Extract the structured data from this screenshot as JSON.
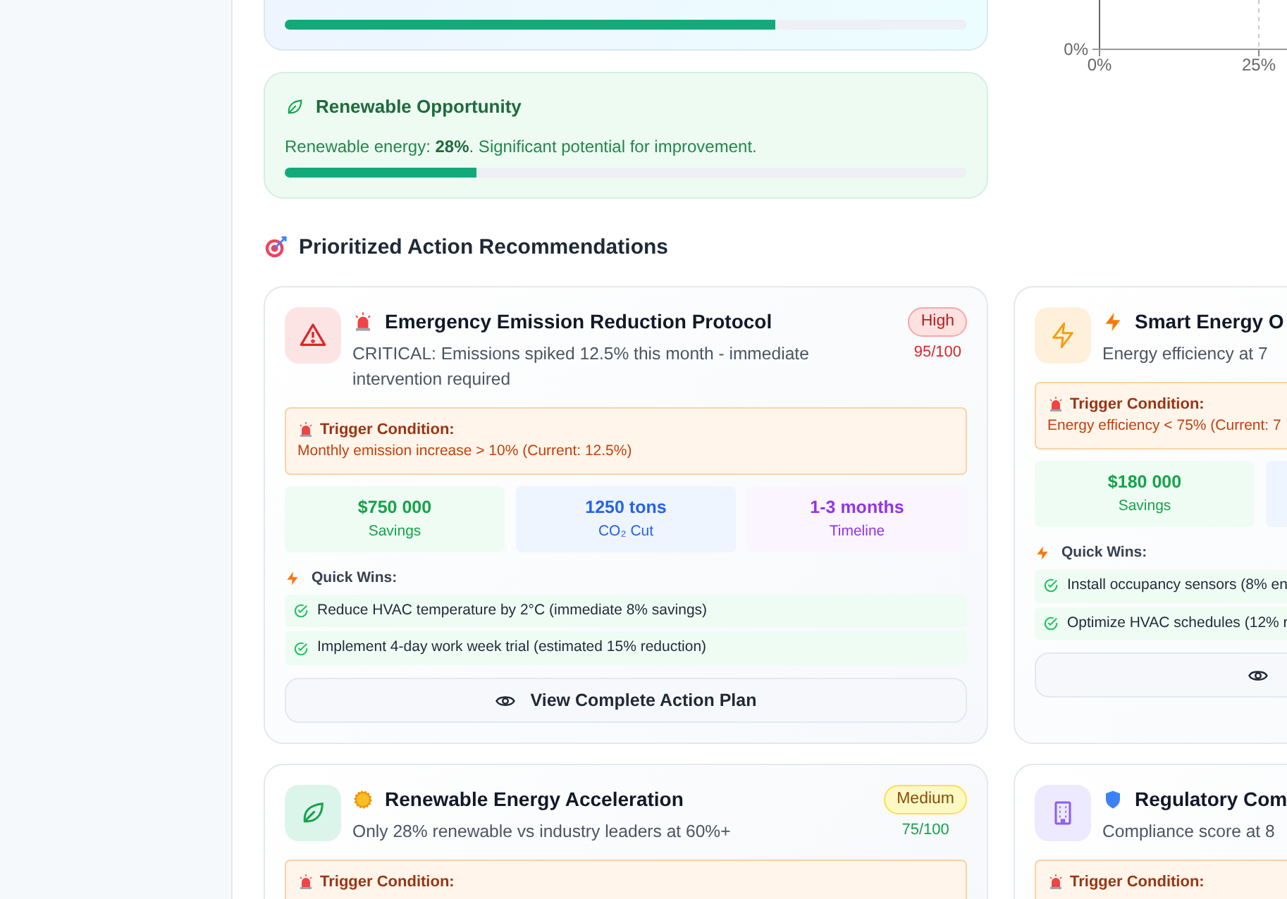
{
  "insights": [
    {
      "kind": "efficiency",
      "level": 0.72
    },
    {
      "kind": "renewable",
      "title": "Renewable Opportunity",
      "text": "Renewable energy: **28%**. Significant potential for improvement.",
      "level": 0.28
    }
  ],
  "chart": {
    "x_tick_labels": [
      "0%",
      "25%"
    ],
    "y_tick_labels": [
      "0%"
    ]
  },
  "recommendations_heading": "Prioritized Action Recommendations",
  "recommendations": [
    {
      "kind": "emergency",
      "title": "Emergency Emission Reduction Protocol",
      "description": "CRITICAL: Emissions spiked 12.5% this month - immediate intervention required",
      "badge": {
        "text": "High",
        "kind": "high"
      },
      "score": "95/100",
      "trigger": {
        "label": "Trigger Condition:",
        "text": "Monthly emission increase > 10% (Current: 12.5%)"
      },
      "metrics": [
        {
          "kind": "savings",
          "value": "$750 000",
          "label": "Savings"
        },
        {
          "kind": "co2",
          "value": "1250 tons",
          "label": "CO₂ Cut"
        },
        {
          "kind": "timeline",
          "value": "1-3 months",
          "label": "Timeline"
        }
      ],
      "quick_wins_label": "Quick Wins:",
      "quick_wins": [
        "Reduce HVAC temperature by 2°C (immediate 8% savings)",
        "Implement 4-day work week trial (estimated 15% reduction)"
      ],
      "button": "View Complete Action Plan"
    },
    {
      "kind": "efficiency",
      "title": "Smart Energy O",
      "description": "Energy efficiency at 7",
      "trigger": {
        "label": "Trigger Condition:",
        "text": "Energy efficiency < 75% (Current: 7"
      },
      "metrics": [
        {
          "kind": "savings",
          "value": "$180 000",
          "label": "Savings"
        },
        {
          "kind": "co2"
        }
      ],
      "quick_wins_label": "Quick Wins:",
      "quick_wins": [
        "Install occupancy sensors (8% en",
        "Optimize HVAC schedules (12% r"
      ]
    },
    {
      "kind": "renewable",
      "title": "Renewable Energy Acceleration",
      "description": "Only 28% renewable vs industry leaders at 60%+",
      "badge": {
        "text": "Medium",
        "kind": "medium"
      },
      "score": "75/100",
      "trigger": {
        "label": "Trigger Condition:"
      }
    },
    {
      "kind": "compliance",
      "title": "Regulatory Com",
      "description": "Compliance score at 8",
      "trigger": {
        "label": "Trigger Condition:"
      }
    }
  ]
}
